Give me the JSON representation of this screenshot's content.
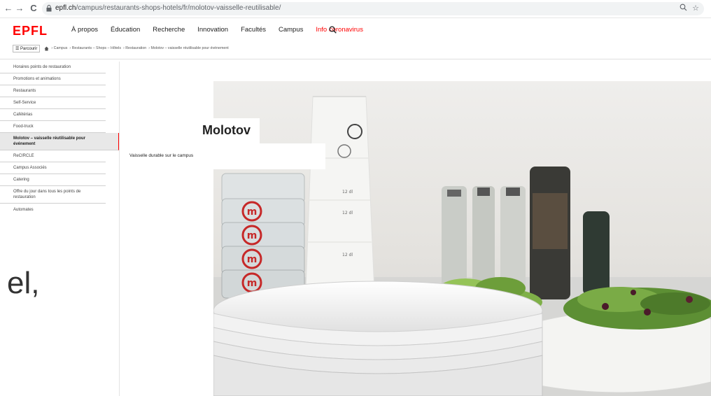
{
  "browser": {
    "url_host": "epfl.ch",
    "url_path": "/campus/restaurants-shops-hotels/fr/molotov-vaisselle-reutilisable/",
    "back_icon": "arrow-left-icon",
    "forward_icon": "arrow-right-icon",
    "reload_icon": "reload-icon"
  },
  "header": {
    "logo": "EPFL",
    "nav": [
      "À propos",
      "Éducation",
      "Recherche",
      "Innovation",
      "Facultés",
      "Campus"
    ],
    "nav_alert": "Info coronavirus",
    "accent_color": "#ff0000"
  },
  "breadcrumb": {
    "parcourir": "☰ Parcourir",
    "items": [
      "› Campus",
      "› Restaurants – Shops – Hôtels",
      "› Restauration",
      "› Molotov – vaisselle réutilisable pour événement"
    ]
  },
  "sidebar": {
    "items": [
      "Horaires points de restauration",
      "Promotions et animations",
      "Restaurants",
      "Self-Service",
      "Cafétérias",
      "Food-truck",
      "Molotov – vaisselle réutilisable pour événement",
      "ReCIRCLE",
      "Campus Associés",
      "Catering",
      "Offre du jour dans tous les points de restauration",
      "Automates"
    ]
  },
  "partial_text": "el,",
  "hero": {
    "title": "Molotov",
    "subtitle": "Vaisselle durable sur le campus",
    "cup_marks": [
      "m",
      "m",
      "m",
      "m",
      "m"
    ],
    "cup_scale": [
      "m",
      "12 dl",
      "12 dl",
      "12 dl"
    ]
  }
}
